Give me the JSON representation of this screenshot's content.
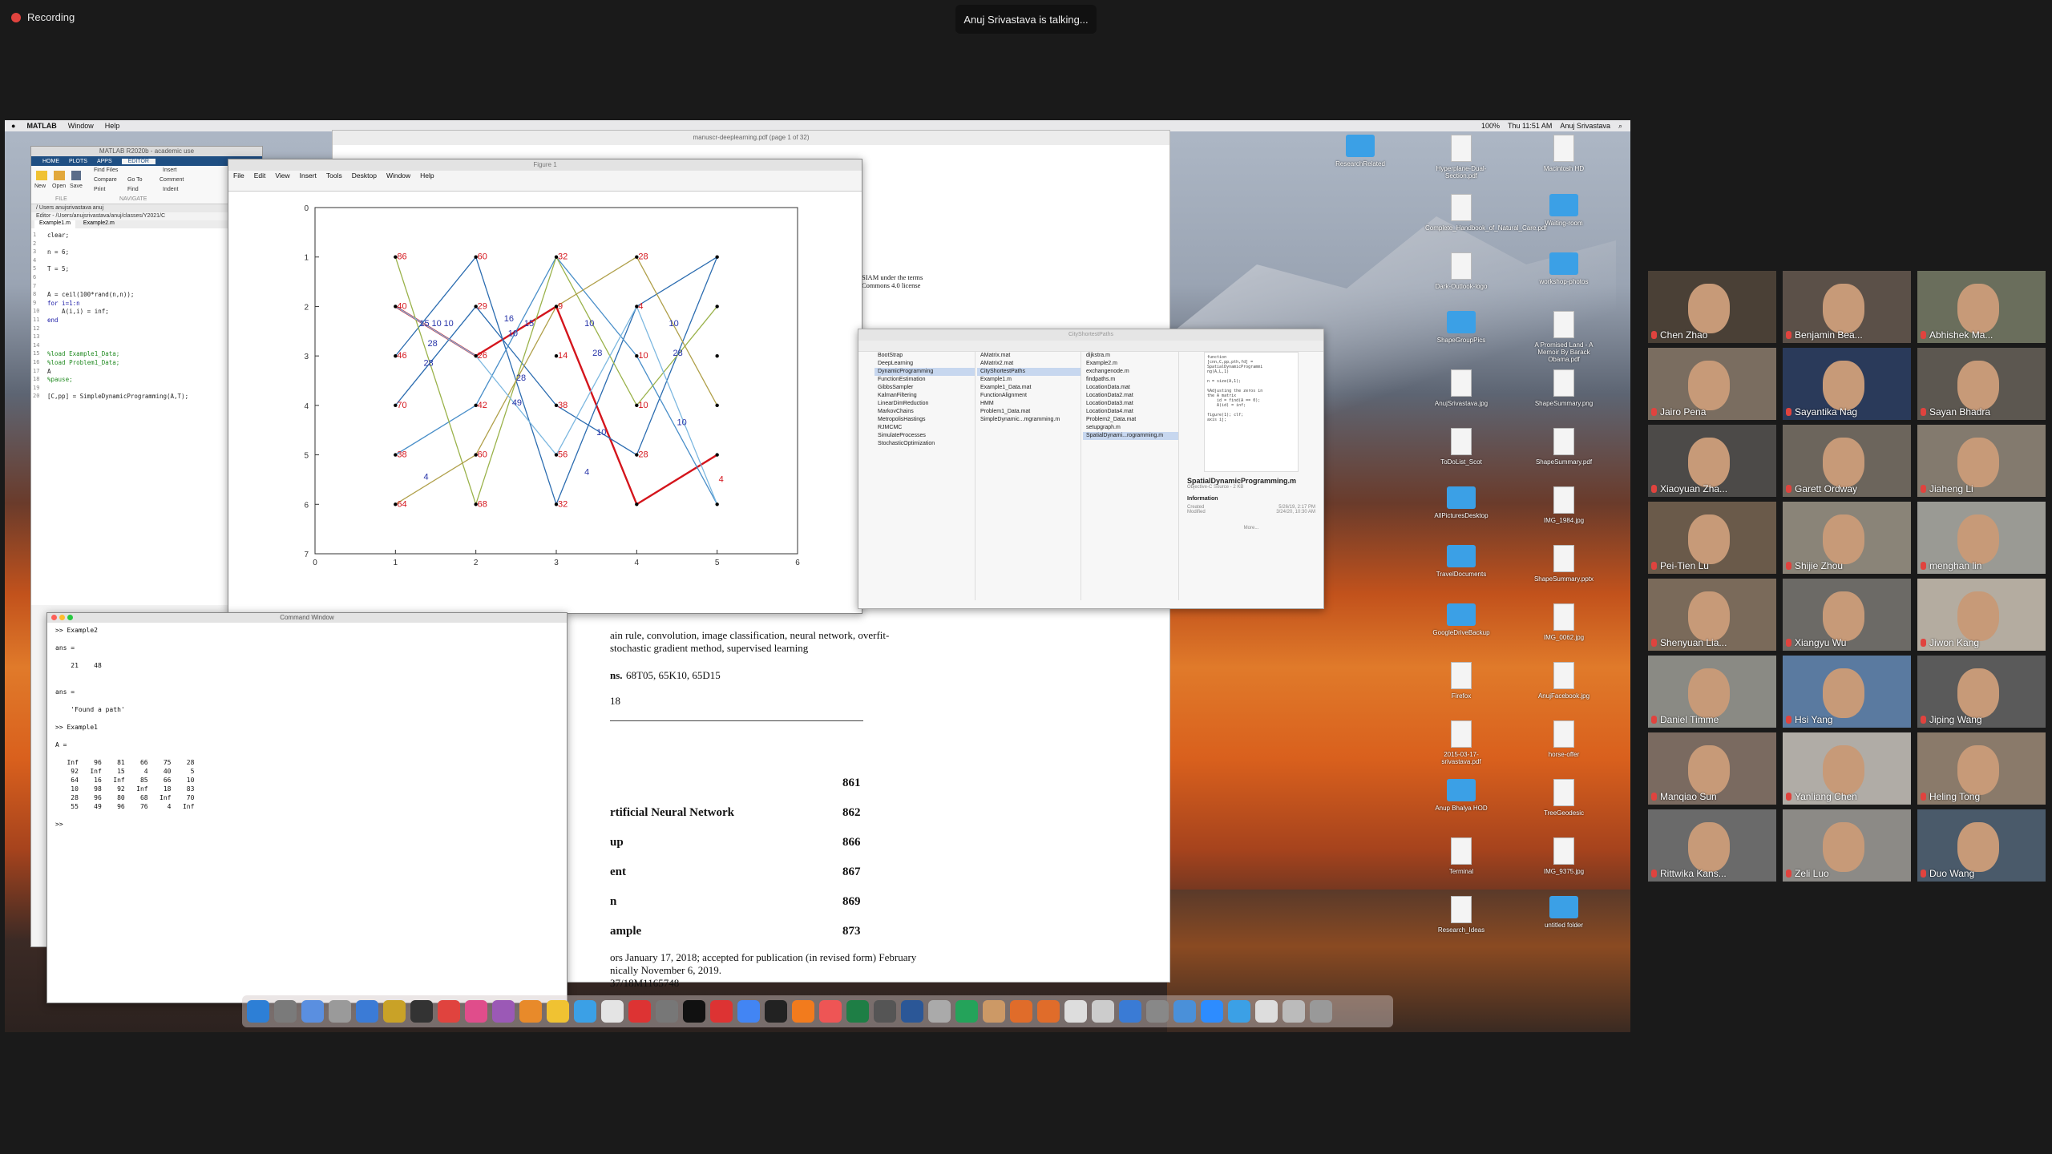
{
  "zoom": {
    "recording_label": "Recording",
    "talking_banner": "Anuj Srivastava is talking..."
  },
  "menubar": {
    "app": "MATLAB",
    "items": [
      "Window",
      "Help"
    ],
    "clock": "Thu 11:51 AM",
    "user": "Anuj Srivastava",
    "battery": "100%"
  },
  "pdf": {
    "title": "manuscr-deeplearning.pdf (page 1 of 32)",
    "license_line1": "SIAM under the terms",
    "license_line2": "Commons 4.0 license",
    "keywords_line1": "ain rule, convolution, image classification, neural network, overfit-",
    "keywords_line2": "stochastic gradient method, supervised learning",
    "ams_label": "ns.",
    "ams_codes": "68T05, 65K10, 65D15",
    "doi_frag": "18",
    "toc": [
      {
        "title": "",
        "page": "861"
      },
      {
        "title": "rtificial Neural Network",
        "page": "862"
      },
      {
        "title": "up",
        "page": "866"
      },
      {
        "title": "ent",
        "page": "867"
      },
      {
        "title": "n",
        "page": "869"
      },
      {
        "title": "ample",
        "page": "873"
      }
    ],
    "footer1": "ors January 17, 2018; accepted for publication (in revised form) February",
    "footer2": "nically November 6, 2019.",
    "footer3": "37/18M1165748"
  },
  "matlab": {
    "title": "MATLAB R2020b - academic use",
    "tabs": [
      "HOME",
      "PLOTS",
      "APPS",
      "EDITOR"
    ],
    "toolbar": [
      "New",
      "Open",
      "Save",
      "Find Files",
      "Compare",
      "Print",
      "Go To",
      "Find",
      "Insert",
      "Comment",
      "Indent"
    ],
    "sections": [
      "FILE",
      "NAVIGATE"
    ],
    "path": "/ Users anujsrivastava anuj",
    "editor_path": "Editor - /Users/anujsrivastava/anuj/classes/Y2021/C",
    "files": [
      "Example1.m",
      "Example2.m"
    ],
    "code": [
      "clear;",
      "",
      "n = 6;",
      "",
      "T = 5;",
      "",
      "",
      "A = ceil(100*rand(n,n));",
      "for i=1:n",
      "    A(i,i) = inf;",
      "end",
      "",
      "",
      "",
      "%load Example1_Data;",
      "%load Problem1_Data;",
      "A",
      "%pause;",
      "",
      "[C,pp] = SimpleDynamicProgramming(A,T);"
    ]
  },
  "figure": {
    "title": "Figure 1",
    "menu": [
      "File",
      "Edit",
      "View",
      "Insert",
      "Tools",
      "Desktop",
      "Window",
      "Help"
    ]
  },
  "chart_data": {
    "type": "line",
    "xlim": [
      0,
      6
    ],
    "ylim": [
      0,
      7
    ],
    "y_reversed": true,
    "xticks": [
      "0",
      "1",
      "2",
      "3",
      "4",
      "5",
      "6"
    ],
    "yticks": [
      "0",
      "1",
      "2",
      "3",
      "4",
      "5",
      "6",
      "7"
    ],
    "node_labels_red": [
      {
        "x": 1,
        "y": 1,
        "t": "86"
      },
      {
        "x": 1,
        "y": 2,
        "t": "40"
      },
      {
        "x": 1,
        "y": 3,
        "t": "46"
      },
      {
        "x": 1,
        "y": 4,
        "t": "70"
      },
      {
        "x": 1,
        "y": 5,
        "t": "38"
      },
      {
        "x": 1,
        "y": 6,
        "t": "64"
      },
      {
        "x": 2,
        "y": 1,
        "t": "60"
      },
      {
        "x": 2,
        "y": 2,
        "t": "29"
      },
      {
        "x": 2,
        "y": 3,
        "t": "26"
      },
      {
        "x": 2,
        "y": 4,
        "t": "42"
      },
      {
        "x": 2,
        "y": 5,
        "t": "60"
      },
      {
        "x": 2,
        "y": 6,
        "t": "68"
      },
      {
        "x": 3,
        "y": 1,
        "t": "32"
      },
      {
        "x": 3,
        "y": 2,
        "t": "9"
      },
      {
        "x": 3,
        "y": 3,
        "t": "14"
      },
      {
        "x": 3,
        "y": 4,
        "t": "38"
      },
      {
        "x": 3,
        "y": 5,
        "t": "56"
      },
      {
        "x": 3,
        "y": 6,
        "t": "32"
      },
      {
        "x": 4,
        "y": 1,
        "t": "28"
      },
      {
        "x": 4,
        "y": 2,
        "t": "4"
      },
      {
        "x": 4,
        "y": 3,
        "t": "10"
      },
      {
        "x": 4,
        "y": 4,
        "t": "10"
      },
      {
        "x": 4,
        "y": 5,
        "t": "28"
      },
      {
        "x": 5,
        "y": 5.5,
        "t": "4"
      }
    ],
    "edge_labels_blue": [
      {
        "x": 1.3,
        "y": 2.4,
        "t": "15"
      },
      {
        "x": 1.45,
        "y": 2.4,
        "t": "10"
      },
      {
        "x": 1.6,
        "y": 2.4,
        "t": "10"
      },
      {
        "x": 1.4,
        "y": 2.8,
        "t": "28"
      },
      {
        "x": 1.35,
        "y": 3.2,
        "t": "28"
      },
      {
        "x": 1.35,
        "y": 5.5,
        "t": "4"
      },
      {
        "x": 2.35,
        "y": 2.3,
        "t": "16"
      },
      {
        "x": 2.4,
        "y": 2.6,
        "t": "10"
      },
      {
        "x": 2.6,
        "y": 2.4,
        "t": "15"
      },
      {
        "x": 2.45,
        "y": 4.0,
        "t": "49"
      },
      {
        "x": 2.5,
        "y": 3.5,
        "t": "28"
      },
      {
        "x": 3.35,
        "y": 2.4,
        "t": "10"
      },
      {
        "x": 3.45,
        "y": 3.0,
        "t": "28"
      },
      {
        "x": 3.5,
        "y": 4.6,
        "t": "10"
      },
      {
        "x": 3.35,
        "y": 5.4,
        "t": "4"
      },
      {
        "x": 4.4,
        "y": 2.4,
        "t": "10"
      },
      {
        "x": 4.45,
        "y": 3.0,
        "t": "28"
      },
      {
        "x": 4.5,
        "y": 4.4,
        "t": "10"
      }
    ],
    "paths": [
      {
        "color": "#d4151c",
        "width": 2.4,
        "pts": [
          [
            1,
            2
          ],
          [
            2,
            3
          ],
          [
            3,
            2
          ],
          [
            4,
            6
          ],
          [
            5,
            5
          ]
        ]
      },
      {
        "color": "#2b6cb0",
        "width": 1.3,
        "pts": [
          [
            1,
            3
          ],
          [
            2,
            1
          ],
          [
            3,
            6
          ],
          [
            4,
            2
          ],
          [
            5,
            1
          ]
        ]
      },
      {
        "color": "#2b6cb0",
        "width": 1.3,
        "pts": [
          [
            1,
            4
          ],
          [
            2,
            2
          ],
          [
            3,
            4
          ],
          [
            4,
            5
          ],
          [
            5,
            1
          ]
        ]
      },
      {
        "color": "#4a8fc9",
        "width": 1.3,
        "pts": [
          [
            1,
            5
          ],
          [
            2,
            4
          ],
          [
            3,
            1
          ],
          [
            4,
            3
          ],
          [
            5,
            6
          ]
        ]
      },
      {
        "color": "#9ab24a",
        "width": 1.3,
        "pts": [
          [
            1,
            1
          ],
          [
            2,
            6
          ],
          [
            3,
            1
          ],
          [
            4,
            4
          ],
          [
            5,
            2
          ]
        ]
      },
      {
        "color": "#b0a04a",
        "width": 1.3,
        "pts": [
          [
            1,
            6
          ],
          [
            2,
            5
          ],
          [
            3,
            2
          ],
          [
            4,
            1
          ],
          [
            5,
            4
          ]
        ]
      },
      {
        "color": "#7db8e0",
        "width": 1.3,
        "pts": [
          [
            1,
            2
          ],
          [
            2,
            3
          ],
          [
            3,
            5
          ],
          [
            4,
            2
          ],
          [
            5,
            6
          ]
        ]
      }
    ]
  },
  "command": {
    "title": "Command Window",
    "body": ">> Example2\n\nans =\n\n    21    48\n\n\nans =\n\n    'Found a path'\n\n>> Example1\n\nA =\n\n   Inf    96    81    66    75    28\n    92   Inf    15     4    40     5\n    64    16   Inf    85    66    10\n    10    98    92   Inf    18    83\n    28    96    80    68   Inf    70\n    55    49    96    76     4   Inf\n\n>>"
  },
  "finder": {
    "title": "CityShortestPaths",
    "col1": [
      "BootStrap",
      "DeepLearning",
      "DynamicProgramming",
      "FunctionEstimation",
      "GibbsSampler",
      "KalmanFiltering",
      "LinearDimReduction",
      "MarkovChains",
      "MetropolisHastings",
      "RJMCMC",
      "SimulateProcesses",
      "StochasticOptimization"
    ],
    "col2": [
      "AMatrix.mat",
      "AMatrix2.mat",
      "CityShortestPaths",
      "Example1.m",
      "Example1_Data.mat",
      "FunctionAlignment",
      "HMM",
      "Problem1_Data.mat",
      "SimpleDynamic...mgramming.m"
    ],
    "col3": [
      "dijkstra.m",
      "Example2.m",
      "exchangenode.m",
      "findpaths.m",
      "LocationData.mat",
      "LocationData2.mat",
      "LocationData3.mat",
      "LocationData4.mat",
      "Problem2_Data.mat",
      "setupgraph.m",
      "SpatialDynami...rogramming.m"
    ],
    "preview_name": "SpatialDynamicProgramming.m",
    "preview_kind": "Objective-C Source - 2 KB",
    "info_label": "Information",
    "created_label": "Created",
    "created": "5/26/19, 2:17 PM",
    "modified_label": "Modified",
    "modified": "3/24/20, 10:30 AM",
    "more": "More..."
  },
  "desktop_icons": [
    [
      "ResearchRelated",
      "folder"
    ],
    [
      "Hyperplane-Dual-Section.pdf",
      "doc"
    ],
    [
      "Macintosh HD",
      "doc"
    ],
    [
      "Complete_Handbook_of_Natural_Care.pdf",
      "doc"
    ],
    [
      "Waiting-room",
      "folder"
    ],
    [
      "Dark-Outlook-logo",
      "doc"
    ],
    [
      "workshop-photos",
      "folder"
    ],
    [
      "ShapeGroupPics",
      "folder"
    ],
    [
      "A Promised Land - A Memoir By Barack Obama.pdf",
      "doc"
    ],
    [
      "AnujSrivastava.jpg",
      "doc"
    ],
    [
      "ShapeSummary.png",
      "doc"
    ],
    [
      "ToDoList_Scot",
      "doc"
    ],
    [
      "ShapeSummary.pdf",
      "doc"
    ],
    [
      "AllPicturesDesktop",
      "folder"
    ],
    [
      "IMG_1984.jpg",
      "doc"
    ],
    [
      "TravelDocuments",
      "folder"
    ],
    [
      "ShapeSummary.pptx",
      "doc"
    ],
    [
      "GoogleDriveBackup",
      "folder"
    ],
    [
      "IMG_0062.jpg",
      "doc"
    ],
    [
      "Firefox",
      "doc"
    ],
    [
      "AnujFacebook.jpg",
      "doc"
    ],
    [
      "2015-03-17-srivastava.pdf",
      "doc"
    ],
    [
      "horse-offer",
      "doc"
    ],
    [
      "Anup Bhalya HOD",
      "folder"
    ],
    [
      "TreeGeodesic",
      "doc"
    ],
    [
      "Terminal",
      "doc"
    ],
    [
      "IMG_9375.jpg",
      "doc"
    ],
    [
      "Research_Ideas",
      "doc"
    ],
    [
      "untitled folder",
      "folder"
    ]
  ],
  "participants": [
    "Chen Zhao",
    "Benjamin Bea...",
    "Abhishek Ma...",
    "Jairo Pena",
    "Sayantika Nag",
    "Sayan Bhadra",
    "Xiaoyuan Zha...",
    "Garett Ordway",
    "Jiaheng Li",
    "Pei-Tien Lu",
    "Shijie Zhou",
    "menghan lin",
    "Shenyuan Lia...",
    "Xiangyu Wu",
    "Jiwon Kang",
    "Daniel Timme",
    "Hsi Yang",
    "Jiping Wang",
    "Manqiao Sun",
    "Yanliang Chen",
    "Heling Tong",
    "Rittwika Kans...",
    "Zeli Luo",
    "Duo Wang"
  ]
}
